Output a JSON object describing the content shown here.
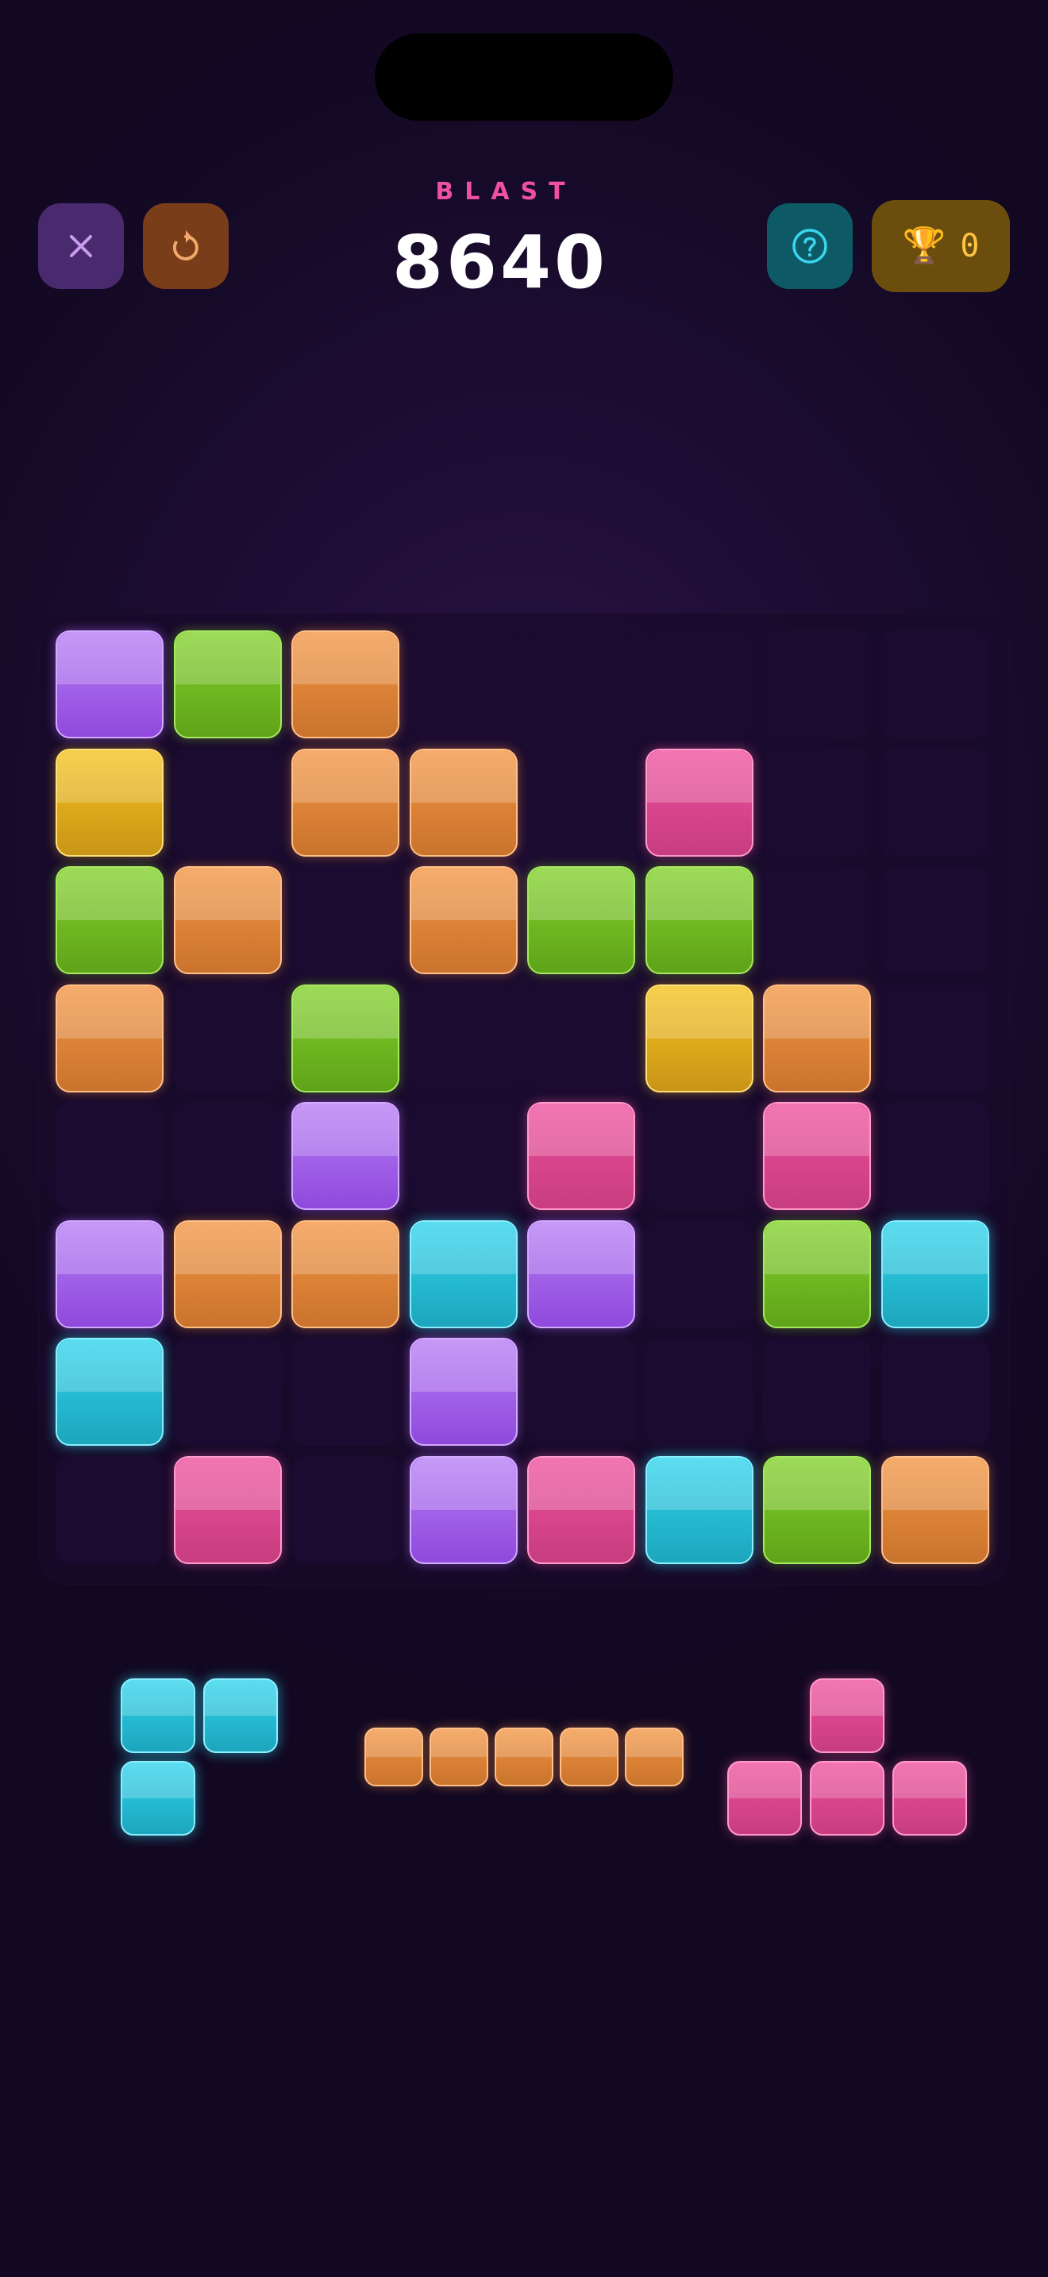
{
  "header": {
    "title": "BLAST",
    "score": "8640",
    "trophy_count": "0",
    "buttons": {
      "close": "close-icon",
      "restart": "restart-icon",
      "help": "help-icon",
      "trophy": "trophy-icon"
    }
  },
  "colors": {
    "purple": "#a565ec",
    "green": "#72bf22",
    "orange": "#e3843a",
    "yellow": "#e8b21b",
    "pink": "#e04790",
    "cyan": "#27c1da",
    "title_accent": "#ef4fa4",
    "trophy_accent": "#ffc443"
  },
  "board": {
    "rows": 8,
    "cols": 8,
    "grid": [
      [
        "purple",
        "green",
        "orange",
        null,
        null,
        null,
        null,
        null
      ],
      [
        "yellow",
        null,
        "orange",
        "orange",
        null,
        "pink",
        null,
        null
      ],
      [
        "green",
        "orange",
        null,
        "orange",
        "green",
        "green",
        null,
        null
      ],
      [
        "orange",
        null,
        "green",
        null,
        null,
        "yellow",
        "orange",
        null
      ],
      [
        null,
        null,
        "purple",
        null,
        "pink",
        null,
        "pink",
        null
      ],
      [
        "purple",
        "orange",
        "orange",
        "cyan",
        "purple",
        null,
        "green",
        "cyan"
      ],
      [
        "cyan",
        null,
        null,
        "purple",
        null,
        null,
        null,
        null
      ],
      [
        null,
        "pink",
        null,
        "purple",
        "pink",
        "cyan",
        "green",
        "orange"
      ]
    ]
  },
  "pieces": [
    {
      "color": "cyan",
      "shape": [
        [
          1,
          1
        ],
        [
          1,
          0
        ]
      ]
    },
    {
      "color": "orange",
      "shape": [
        [
          1,
          1,
          1,
          1,
          1
        ]
      ]
    },
    {
      "color": "pink",
      "shape": [
        [
          0,
          1,
          0
        ],
        [
          1,
          1,
          1
        ]
      ]
    }
  ]
}
